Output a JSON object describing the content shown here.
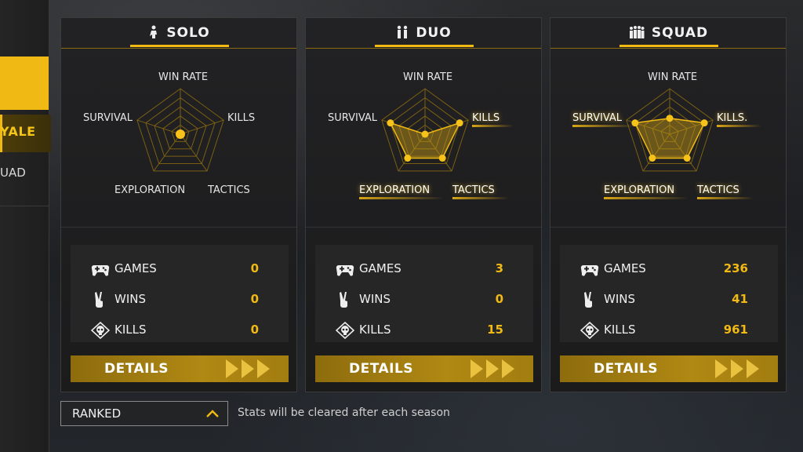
{
  "sidebar": {
    "items": [
      {
        "label": ""
      },
      {
        "label": "YALE"
      },
      {
        "label": "UAD"
      }
    ]
  },
  "radar_labels": {
    "top": "WIN RATE",
    "left": "SURVIVAL",
    "right": "KILLS",
    "bottom_left": "EXPLORATION",
    "bottom_right": "TACTICS"
  },
  "stat_labels": {
    "games": "GAMES",
    "wins": "WINS",
    "kills": "KILLS"
  },
  "modes": [
    {
      "title": "SOLO",
      "games": "0",
      "wins": "0",
      "kills": "0",
      "details_label": "DETAILS",
      "radar": {
        "win_rate": 0.1,
        "kills": 0.0,
        "tactics": 0.0,
        "exploration": 0.0,
        "survival": 0.0
      }
    },
    {
      "title": "DUO",
      "games": "3",
      "wins": "0",
      "kills": "15",
      "details_label": "DETAILS",
      "radar": {
        "win_rate": 0.0,
        "kills": 0.8,
        "tactics": 0.65,
        "exploration": 0.65,
        "survival": 0.8
      }
    },
    {
      "title": "SQUAD",
      "games": "236",
      "wins": "41",
      "kills": "961",
      "details_label": "DETAILS",
      "radar": {
        "win_rate": 0.35,
        "kills": 0.8,
        "tactics": 0.65,
        "exploration": 0.65,
        "survival": 0.8
      }
    }
  ],
  "footer": {
    "dropdown_value": "RANKED",
    "note": "Stats will be cleared after each season"
  },
  "colors": {
    "accent": "#f1b913",
    "card_bg": "#1e1e1f"
  }
}
